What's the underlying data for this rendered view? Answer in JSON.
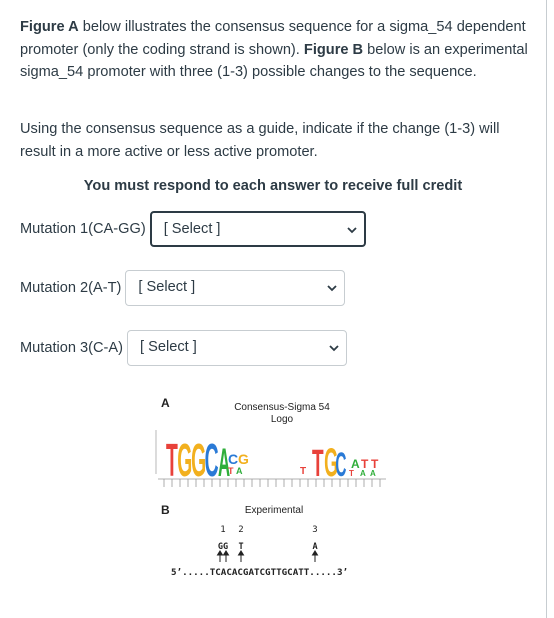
{
  "question": {
    "paragraph1": [
      {
        "text": "Figure A",
        "bold": true
      },
      {
        "text": " below illustrates the consensus sequence for a sigma_54 dependent promoter (only the coding strand is shown). ",
        "bold": false
      },
      {
        "text": "Figure B",
        "bold": true
      },
      {
        "text": " below is an experimental sigma_54 promoter with three (1-3) possible changes to the sequence.",
        "bold": false
      }
    ],
    "paragraph2": "Using the consensus sequence as a guide, indicate if the change (1-3) will result in a more active or less active promoter.",
    "notice": "You must respond to each answer to receive full credit"
  },
  "mutations": [
    {
      "label": "Mutation 1(CA-GG)",
      "selected": "[ Select ]"
    },
    {
      "label": "Mutation 2(A-T)",
      "selected": "[ Select ]"
    },
    {
      "label": "Mutation 3(C-A)",
      "selected": "[ Select ]"
    }
  ],
  "figure": {
    "panel_a_label": "A",
    "logo_title_line1": "Consensus-Sigma 54",
    "logo_title_line2": "Logo",
    "panel_b_label": "B",
    "experimental_label": "Experimental",
    "mark_1": "1",
    "mark_2": "2",
    "mark_3": "3",
    "change_1": "GG",
    "change_2": "T",
    "change_3": "A",
    "sequence": "5’.....TCACACGATCGTTGCATT.....3’"
  },
  "colors": {
    "text": "#2d3b45",
    "border": "#c7cdd1",
    "logo_T": "#e8413a",
    "logo_G": "#f2b01e",
    "logo_C": "#2a7ad6",
    "logo_A": "#2fae3a"
  }
}
